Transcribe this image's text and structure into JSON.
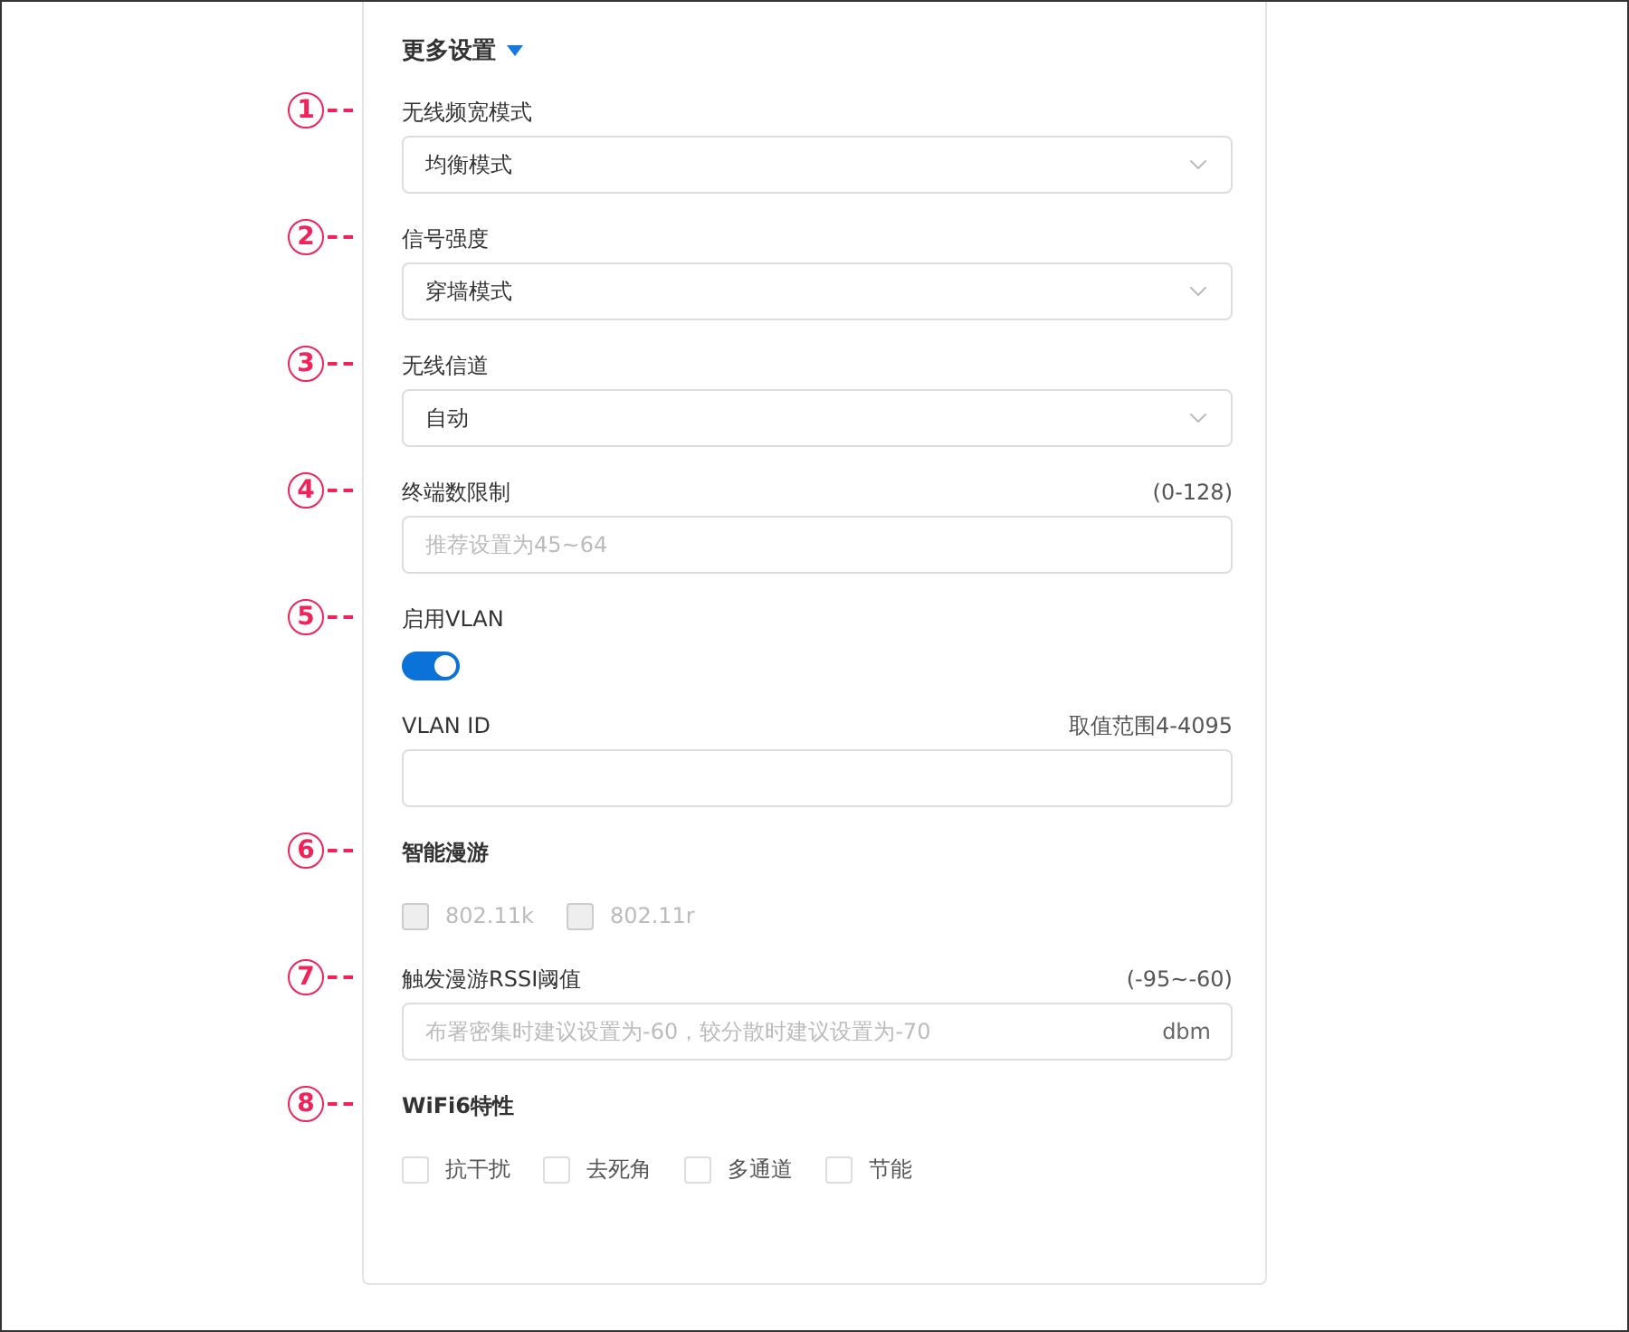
{
  "header": {
    "title": "更多设置",
    "expanded": true
  },
  "sections": [
    {
      "marker": "1",
      "kind": "select",
      "label": "无线频宽模式",
      "value": "均衡模式"
    },
    {
      "marker": "2",
      "kind": "select",
      "label": "信号强度",
      "value": "穿墙模式"
    },
    {
      "marker": "3",
      "kind": "select",
      "label": "无线信道",
      "value": "自动"
    },
    {
      "marker": "4",
      "kind": "input",
      "label": "终端数限制",
      "hint": "(0-128)",
      "placeholder": "推荐设置为45~64"
    },
    {
      "marker": "5",
      "kind": "switch",
      "label": "启用VLAN",
      "on": true
    },
    {
      "kind": "input",
      "label": "VLAN ID",
      "hint": "取值范围4-4095"
    },
    {
      "marker": "6",
      "kind": "checks",
      "label": "智能漫游",
      "options": [
        {
          "label": "802.11k",
          "checked": false,
          "disabled": true
        },
        {
          "label": "802.11r",
          "checked": false,
          "disabled": true
        }
      ]
    },
    {
      "marker": "7",
      "kind": "input",
      "label": "触发漫游RSSI阈值",
      "hint": "(-95~-60)",
      "placeholder": "布署密集时建议设置为-60，较分散时建议设置为-70",
      "suffix": "dbm"
    },
    {
      "marker": "8",
      "kind": "checks",
      "label": "WiFi6特性",
      "options": [
        {
          "label": "抗干扰",
          "checked": false,
          "disabled": false
        },
        {
          "label": "去死角",
          "checked": false,
          "disabled": false
        },
        {
          "label": "多通道",
          "checked": false,
          "disabled": false
        },
        {
          "label": "节能",
          "checked": false,
          "disabled": false
        }
      ]
    }
  ]
}
